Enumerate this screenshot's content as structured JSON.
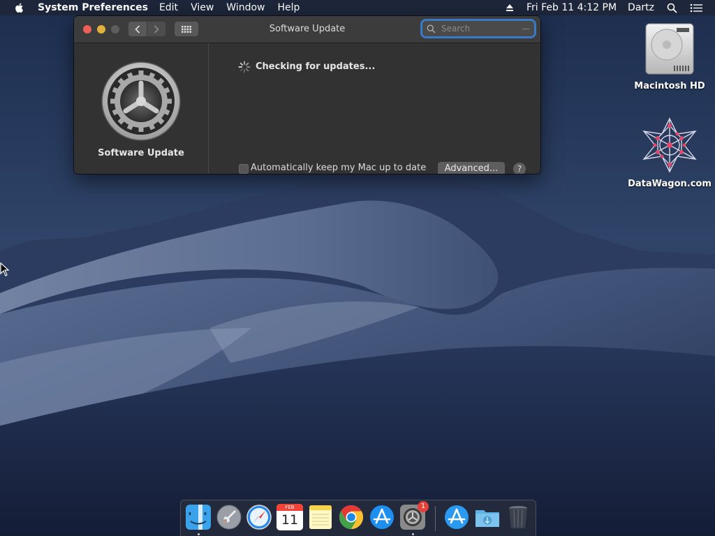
{
  "menubar": {
    "app_name": "System Preferences",
    "menus": [
      "Edit",
      "View",
      "Window",
      "Help"
    ],
    "clock": "Fri Feb 11  4:12 PM",
    "user": "Dartz"
  },
  "window": {
    "title": "Software Update",
    "search": {
      "placeholder": "Search",
      "value": ""
    },
    "sidebar_label": "Software Update",
    "status": "Checking for updates...",
    "auto_update_label": "Automatically keep my Mac up to date",
    "auto_update_checked": false,
    "advanced_label": "Advanced...",
    "help_label": "?"
  },
  "desktop": {
    "icons": [
      {
        "label": "Macintosh HD",
        "icon": "hard-drive-icon"
      },
      {
        "label": "DataWagon.com",
        "icon": "network-star-icon"
      }
    ]
  },
  "dock": {
    "items": [
      {
        "name": "finder",
        "running": true
      },
      {
        "name": "launchpad",
        "running": false
      },
      {
        "name": "safari",
        "running": false
      },
      {
        "name": "calendar",
        "running": false,
        "month": "FEB",
        "day": "11"
      },
      {
        "name": "notes",
        "running": false
      },
      {
        "name": "chrome",
        "running": false
      },
      {
        "name": "app-store",
        "running": false
      },
      {
        "name": "system-preferences",
        "running": true,
        "badge": "1"
      },
      {
        "name": "app-store-downloads",
        "running": false
      },
      {
        "name": "downloads-folder",
        "running": false
      },
      {
        "name": "trash",
        "running": false
      }
    ]
  },
  "colors": {
    "window_bg": "#323232",
    "focus_ring": "#3a78c8",
    "close": "#ec5f57",
    "minimize": "#e0b13b",
    "badge": "#e8413a"
  }
}
